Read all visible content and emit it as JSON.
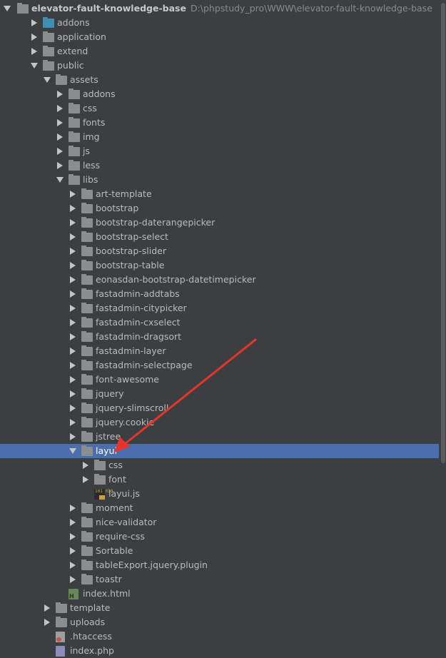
{
  "project": {
    "name": "elevator-fault-knowledge-base",
    "path": "D:\\phpstudy_pro\\WWW\\elevator-fault-knowledge-base"
  },
  "tree": [
    {
      "label": "addons",
      "depth": 1,
      "type": "folder",
      "color": "teal",
      "state": "collapsed"
    },
    {
      "label": "application",
      "depth": 1,
      "type": "folder",
      "color": "gray",
      "state": "collapsed"
    },
    {
      "label": "extend",
      "depth": 1,
      "type": "folder",
      "color": "gray",
      "state": "collapsed"
    },
    {
      "label": "public",
      "depth": 1,
      "type": "folder",
      "color": "gray",
      "state": "expanded"
    },
    {
      "label": "assets",
      "depth": 2,
      "type": "folder",
      "color": "gray",
      "state": "expanded"
    },
    {
      "label": "addons",
      "depth": 3,
      "type": "folder",
      "color": "gray",
      "state": "collapsed"
    },
    {
      "label": "css",
      "depth": 3,
      "type": "folder",
      "color": "gray",
      "state": "collapsed"
    },
    {
      "label": "fonts",
      "depth": 3,
      "type": "folder",
      "color": "gray",
      "state": "collapsed"
    },
    {
      "label": "img",
      "depth": 3,
      "type": "folder",
      "color": "gray",
      "state": "collapsed"
    },
    {
      "label": "js",
      "depth": 3,
      "type": "folder",
      "color": "gray",
      "state": "collapsed"
    },
    {
      "label": "less",
      "depth": 3,
      "type": "folder",
      "color": "gray",
      "state": "collapsed"
    },
    {
      "label": "libs",
      "depth": 3,
      "type": "folder",
      "color": "gray",
      "state": "expanded"
    },
    {
      "label": "art-template",
      "depth": 4,
      "type": "folder",
      "color": "gray",
      "state": "collapsed"
    },
    {
      "label": "bootstrap",
      "depth": 4,
      "type": "folder",
      "color": "gray",
      "state": "collapsed"
    },
    {
      "label": "bootstrap-daterangepicker",
      "depth": 4,
      "type": "folder",
      "color": "gray",
      "state": "collapsed"
    },
    {
      "label": "bootstrap-select",
      "depth": 4,
      "type": "folder",
      "color": "gray",
      "state": "collapsed"
    },
    {
      "label": "bootstrap-slider",
      "depth": 4,
      "type": "folder",
      "color": "gray",
      "state": "collapsed"
    },
    {
      "label": "bootstrap-table",
      "depth": 4,
      "type": "folder",
      "color": "gray",
      "state": "collapsed"
    },
    {
      "label": "eonasdan-bootstrap-datetimepicker",
      "depth": 4,
      "type": "folder",
      "color": "gray",
      "state": "collapsed"
    },
    {
      "label": "fastadmin-addtabs",
      "depth": 4,
      "type": "folder",
      "color": "gray",
      "state": "collapsed"
    },
    {
      "label": "fastadmin-citypicker",
      "depth": 4,
      "type": "folder",
      "color": "gray",
      "state": "collapsed"
    },
    {
      "label": "fastadmin-cxselect",
      "depth": 4,
      "type": "folder",
      "color": "gray",
      "state": "collapsed"
    },
    {
      "label": "fastadmin-dragsort",
      "depth": 4,
      "type": "folder",
      "color": "gray",
      "state": "collapsed"
    },
    {
      "label": "fastadmin-layer",
      "depth": 4,
      "type": "folder",
      "color": "gray",
      "state": "collapsed"
    },
    {
      "label": "fastadmin-selectpage",
      "depth": 4,
      "type": "folder",
      "color": "gray",
      "state": "collapsed"
    },
    {
      "label": "font-awesome",
      "depth": 4,
      "type": "folder",
      "color": "gray",
      "state": "collapsed"
    },
    {
      "label": "jquery",
      "depth": 4,
      "type": "folder",
      "color": "gray",
      "state": "collapsed"
    },
    {
      "label": "jquery-slimscroll",
      "depth": 4,
      "type": "folder",
      "color": "gray",
      "state": "collapsed"
    },
    {
      "label": "jquery.cookie",
      "depth": 4,
      "type": "folder",
      "color": "gray",
      "state": "collapsed"
    },
    {
      "label": "jstree",
      "depth": 4,
      "type": "folder",
      "color": "gray",
      "state": "collapsed"
    },
    {
      "label": "layui",
      "depth": 4,
      "type": "folder",
      "color": "gray",
      "state": "expanded",
      "selected": true
    },
    {
      "label": "css",
      "depth": 5,
      "type": "folder",
      "color": "gray",
      "state": "collapsed"
    },
    {
      "label": "font",
      "depth": 5,
      "type": "folder",
      "color": "gray",
      "state": "collapsed"
    },
    {
      "label": "layui.js",
      "depth": 5,
      "type": "file-js",
      "state": "leaf"
    },
    {
      "label": "moment",
      "depth": 4,
      "type": "folder",
      "color": "gray",
      "state": "collapsed"
    },
    {
      "label": "nice-validator",
      "depth": 4,
      "type": "folder",
      "color": "gray",
      "state": "collapsed"
    },
    {
      "label": "require-css",
      "depth": 4,
      "type": "folder",
      "color": "gray",
      "state": "collapsed"
    },
    {
      "label": "Sortable",
      "depth": 4,
      "type": "folder",
      "color": "gray",
      "state": "collapsed"
    },
    {
      "label": "tableExport.jquery.plugin",
      "depth": 4,
      "type": "folder",
      "color": "gray",
      "state": "collapsed"
    },
    {
      "label": "toastr",
      "depth": 4,
      "type": "folder",
      "color": "gray",
      "state": "collapsed"
    },
    {
      "label": "index.html",
      "depth": 3,
      "type": "file-html",
      "state": "leaf"
    },
    {
      "label": "template",
      "depth": 2,
      "type": "folder",
      "color": "gray",
      "state": "collapsed"
    },
    {
      "label": "uploads",
      "depth": 2,
      "type": "folder",
      "color": "gray",
      "state": "collapsed"
    },
    {
      "label": ".htaccess",
      "depth": 2,
      "type": "file-ht",
      "state": "leaf"
    },
    {
      "label": "index.php",
      "depth": 2,
      "type": "file-php",
      "state": "leaf"
    }
  ],
  "colors": {
    "background": "#3c3f41",
    "selection": "#4b6eaf",
    "annotation_arrow": "#e8342b"
  },
  "icons": {
    "folder": "folder-icon",
    "expand": "chevron-right-icon",
    "collapse": "chevron-down-icon",
    "js_file": "js-file-icon",
    "html_file": "html-file-icon"
  }
}
